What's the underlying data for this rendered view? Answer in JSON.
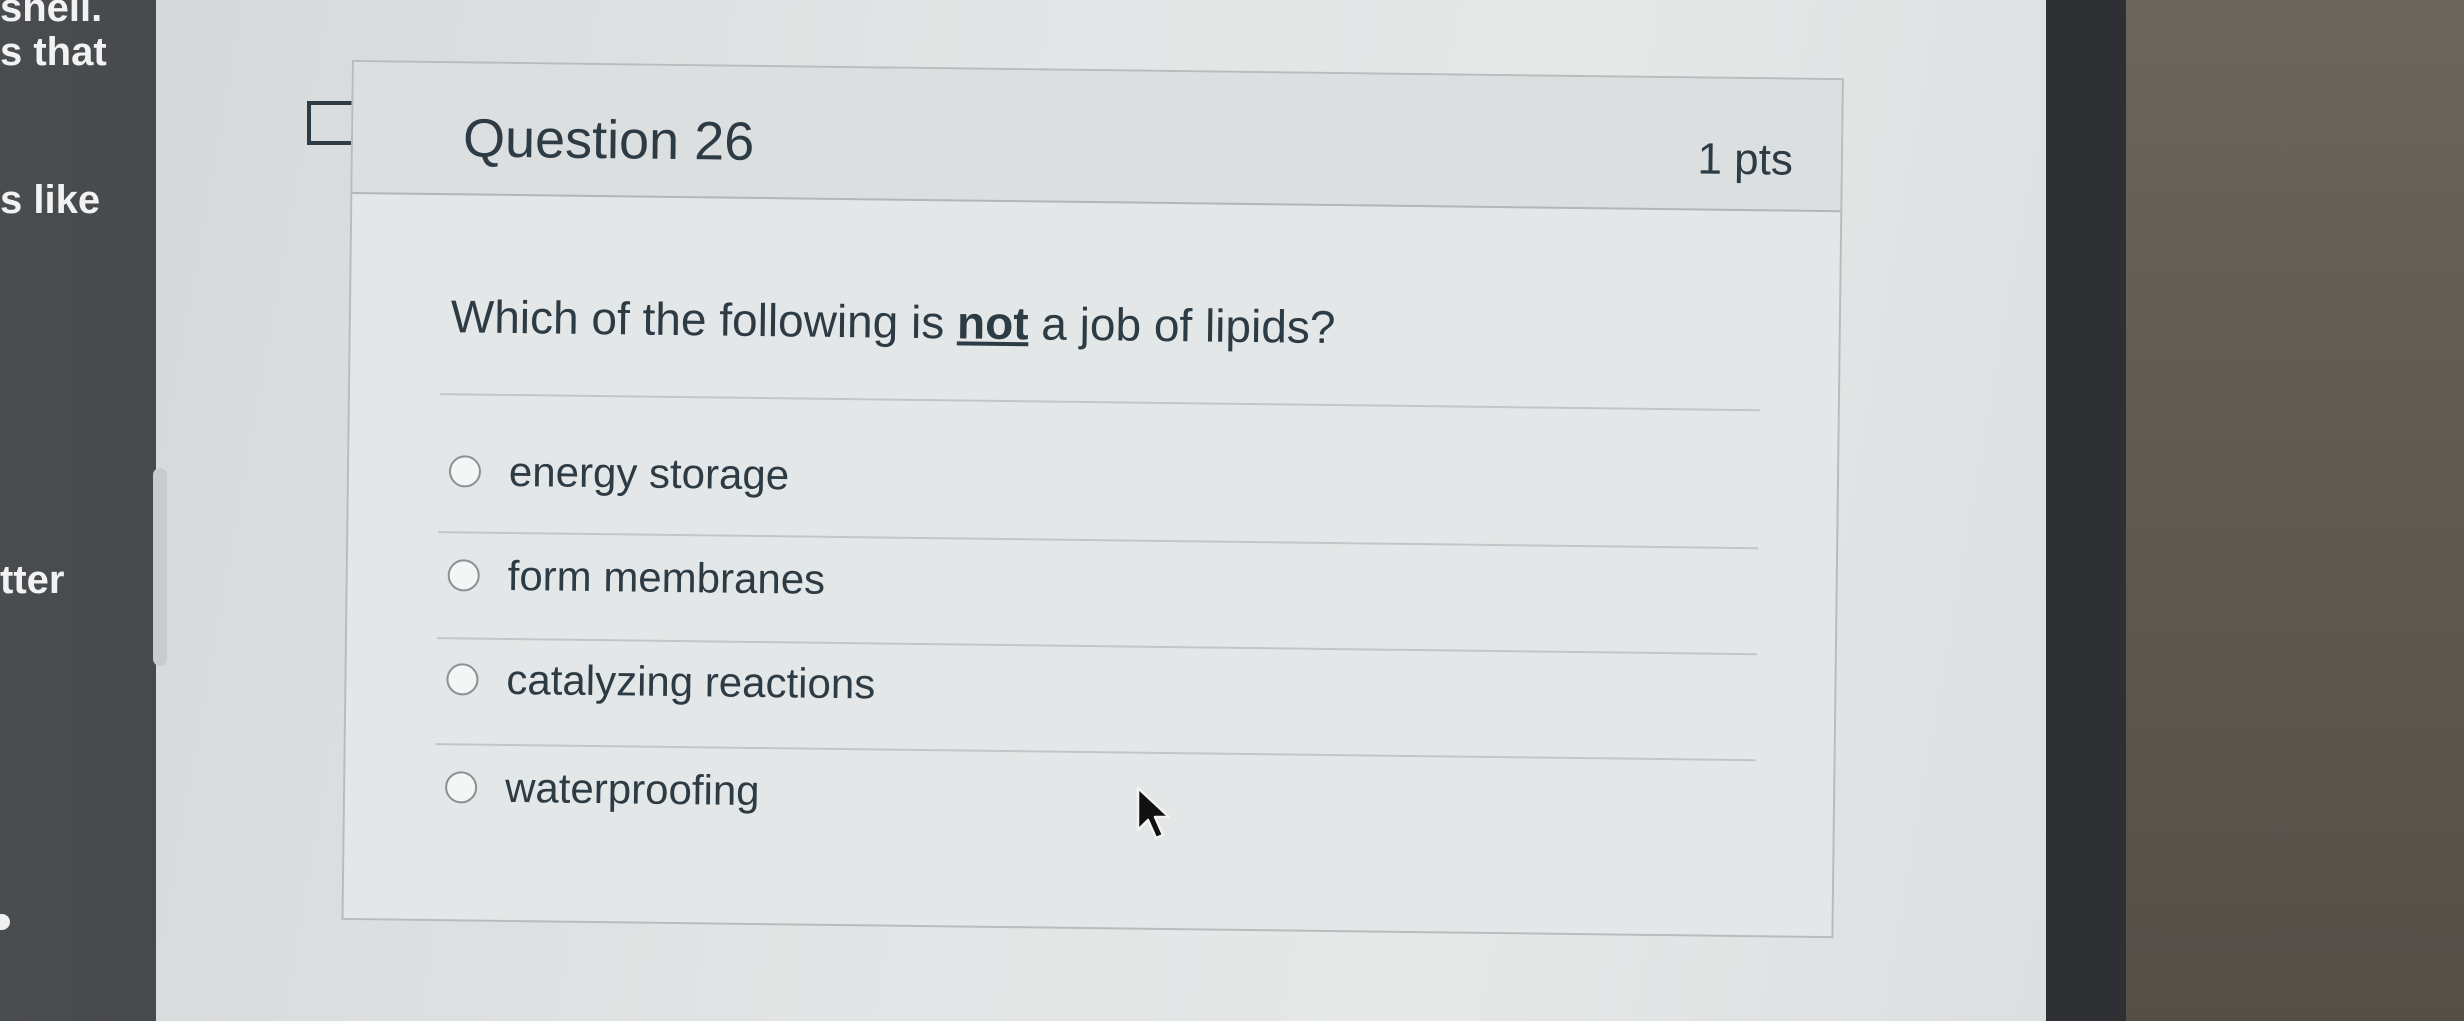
{
  "left_panel": {
    "fragments": [
      "shell.",
      "s that",
      "s like",
      "tter"
    ]
  },
  "question": {
    "title": "Question 26",
    "points": "1 pts",
    "text_before": "Which of the following is ",
    "text_emphasis": "not",
    "text_after": " a job of lipids?",
    "answers": [
      {
        "label": "energy storage",
        "selected": false
      },
      {
        "label": "form membranes",
        "selected": false
      },
      {
        "label": "catalyzing reactions",
        "selected": false
      },
      {
        "label": "waterproofing",
        "selected": false
      }
    ]
  },
  "icons": {
    "flag": "bookmark-flag-icon",
    "cursor": "mouse-pointer-icon"
  },
  "colors": {
    "text": "#2d3b45",
    "page_background": "#e4e7e7",
    "border": "#b9bcbe"
  }
}
